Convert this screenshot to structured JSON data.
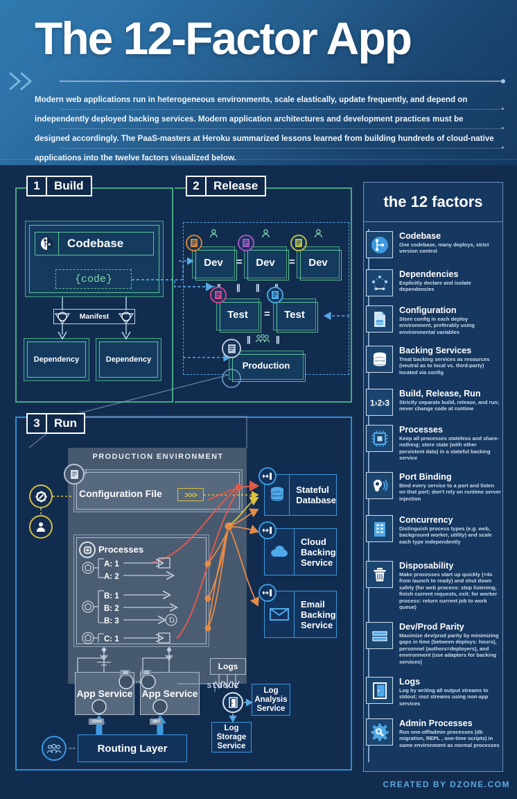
{
  "header": {
    "title": "The 12-Factor App",
    "subtitle": "Modern web applications run in heterogeneous environments, scale elastically, update frequently, and depend on independently deployed backing services. Modern application architectures and development practices must be designed accordingly. The PaaS-masters at Heroku summarized lessons learned from building hundreds of cloud-native applications into the twelve factors visualized below.",
    "chevron_icon": "double-chevron-right-icon"
  },
  "stages": {
    "build": {
      "number": "1",
      "name": "Build"
    },
    "release": {
      "number": "2",
      "name": "Release"
    },
    "run": {
      "number": "3",
      "name": "Run"
    }
  },
  "build": {
    "codebase_label": "Codebase",
    "codebase_icon": "git-branch-icon",
    "code_chip": "{code}",
    "manifest_label": "Manifest",
    "dependencies": [
      "Dependency",
      "Dependency"
    ]
  },
  "release": {
    "dev_boxes": [
      "Dev",
      "Dev",
      "Dev"
    ],
    "test_boxes": [
      "Test",
      "Test"
    ],
    "production_label": "Production",
    "equals": [
      "=",
      "="
    ],
    "test_equals": "=",
    "parallel_marks": [
      "||",
      "||",
      "||",
      "||",
      "||",
      "||"
    ],
    "user_icon": "person-icon",
    "group_icon": "people-group-icon",
    "doc_icon": "document-icon"
  },
  "run": {
    "environment_title": "PRODUCTION ENVIRONMENT",
    "config_file_label": "Configuration File",
    "config_chip": ">>>",
    "config_icon": "config-doc-icon",
    "gear_icon": "gear-wrench-icon",
    "person_icon": "person-badge-icon",
    "processes_title": "Processes",
    "processes_icon": "chip-icon",
    "process_rows": [
      {
        "label": "A: 1",
        "has_box": true,
        "has_trash": false
      },
      {
        "label": "A: 2",
        "has_box": false,
        "has_trash": false
      },
      {
        "label": "B: 1",
        "has_box": false,
        "has_trash": false
      },
      {
        "label": "B: 2",
        "has_box": false,
        "has_trash": false
      },
      {
        "label": "B: 3",
        "has_box": false,
        "has_trash": true
      },
      {
        "label": "C: 1",
        "has_box": true,
        "has_trash": false
      }
    ],
    "app_services": [
      {
        "label": "App Service",
        "port_top": ":80",
        "port_bottom": ":5000"
      },
      {
        "label": "App Service",
        "port_top": ":25",
        "port_bottom": ":867"
      }
    ],
    "logs_label": "Logs",
    "stdout_label": "stdout",
    "log_door_icon": "door-icon",
    "log_analysis_label": "Log Analysis Service",
    "log_storage_label": "Log Storage Service",
    "routing_layer_label": "Routing Layer",
    "routing_icon": "users-group-icon",
    "backing_services": [
      {
        "label": "Stateful Database",
        "icon": "database-icon",
        "port_icon": "port-binding-icon"
      },
      {
        "label": "Cloud Backing Service",
        "icon": "cloud-icon",
        "port_icon": "port-binding-icon"
      },
      {
        "label": "Email Backing Service",
        "icon": "envelope-icon",
        "port_icon": "port-binding-icon"
      }
    ]
  },
  "sidebar": {
    "title": "the 12 factors",
    "factors": [
      {
        "name": "Codebase",
        "desc": "One codebase, many deploys, strict version control",
        "icon": "git-branch-icon"
      },
      {
        "name": "Dependencies",
        "desc": "Explicitly declare and isolate dependencies",
        "icon": "dependency-graph-icon"
      },
      {
        "name": "Configuration",
        "desc": "Store config in each deploy environment, preferably using environmental variables",
        "icon": "yml-file-icon"
      },
      {
        "name": "Backing Services",
        "desc": "Treat backing services as resources (neutral as to local vs. third-party) located via config",
        "icon": "database-icon"
      },
      {
        "name": "Build, Release, Run",
        "desc": "Strictly separate build, release, and run; never change code at runtime",
        "icon": "1-2-3-icon"
      },
      {
        "name": "Processes",
        "desc": "Keep all processes stateless and share-nothing; store state (with other persistent data) in a stateful backing service",
        "icon": "chip-icon"
      },
      {
        "name": "Port Binding",
        "desc": "Bind every service to a port and listen on that port; don't rely on runtime server injection",
        "icon": "ear-listening-icon"
      },
      {
        "name": "Concurrency",
        "desc": "Distinguish process types (e.g. web, background worker, utility) and scale each type independently",
        "icon": "building-icon"
      },
      {
        "name": "Disposability",
        "desc": "Make processes start up quickly (<4s from launch to ready) and shut down safely (for web process: stop listening, finish current requests, exit; for worker process: return current job to work queue)",
        "icon": "trash-icon"
      },
      {
        "name": "Dev/Prod Parity",
        "desc": "Maximize dev/prod parity by minimizing gaps in time (between deploys: hours), personnel (authors=deployers), and environment (use adapters for backing services)",
        "icon": "equals-bars-icon"
      },
      {
        "name": "Logs",
        "desc": "Log by writing all output streams to stdout; rout streams using non-app services",
        "icon": "door-icon"
      },
      {
        "name": "Admin Processes",
        "desc": "Run one-off/admin processes (db migration, REPL , one-time scripts) in same environment as normal processes",
        "icon": "gear-wrench-icon"
      }
    ]
  },
  "footer": {
    "credit": "CREATED BY DZONE.COM"
  },
  "colors": {
    "header_blue": "#2d72a8",
    "page_blue": "#122c4f",
    "green_accent": "#5fc39a",
    "blue_accent": "#3d9ae0",
    "yellow_accent": "#ddc23f",
    "orange_accent": "#e58b4a",
    "red_accent": "#e05a4a",
    "gray_env": "#4b5d72"
  }
}
